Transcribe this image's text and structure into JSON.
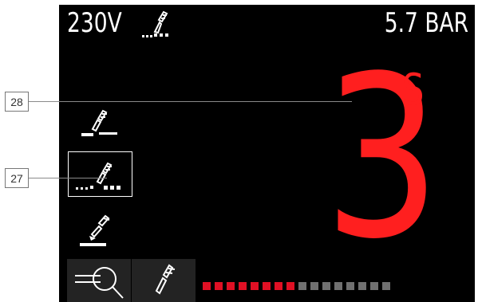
{
  "header": {
    "voltage": "230V",
    "pressure": "5.7 BAR"
  },
  "timer": {
    "value": "3",
    "unit": "S"
  },
  "callouts": {
    "top": "28",
    "mode": "27"
  },
  "modes": [
    {
      "icon": "mig-torch-icon",
      "selected": false
    },
    {
      "icon": "pulse-torch-icon",
      "selected": true
    },
    {
      "icon": "arc-torch-icon",
      "selected": false
    }
  ],
  "bottom_buttons": [
    {
      "icon": "inspect-icon"
    },
    {
      "icon": "torch-icon"
    }
  ],
  "progress": {
    "active_segments": 8,
    "total_segments": 16,
    "active_color": "#e01024",
    "inactive_color": "#707070"
  },
  "colors": {
    "screen": "#000000",
    "timer": "#ff1f1f",
    "text": "#ffffff"
  }
}
